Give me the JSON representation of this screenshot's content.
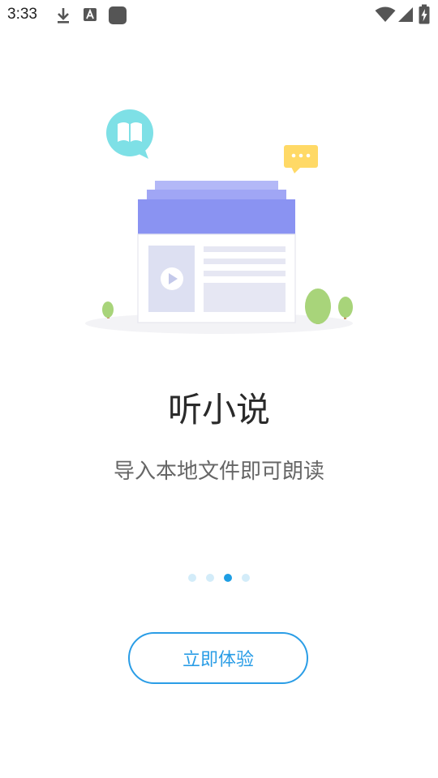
{
  "status_bar": {
    "time": "3:33",
    "icons": [
      "download-icon",
      "font-a-icon",
      "app-square-icon",
      "wifi-icon",
      "signal-icon",
      "battery-charging-icon"
    ]
  },
  "onboarding": {
    "title": "听小说",
    "subtitle": "导入本地文件即可朗读",
    "page_count": 4,
    "active_page": 3
  },
  "actions": {
    "start_label": "立即体验"
  },
  "colors": {
    "accent": "#2a9de6",
    "indicator_active": "#1e9ee4",
    "indicator_inactive": "#d3ecf9",
    "book_header": "#8a93f2",
    "bubble_teal": "#7ee0e6",
    "bubble_yellow": "#ffd966",
    "tree_green": "#a8d47a"
  }
}
